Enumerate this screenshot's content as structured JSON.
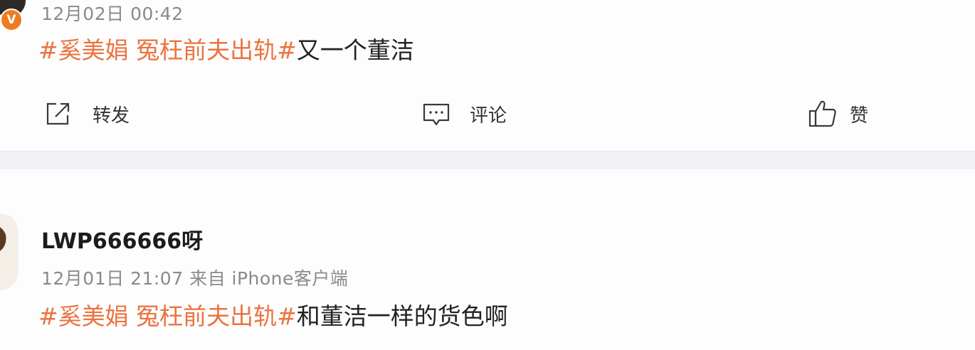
{
  "posts": [
    {
      "timestamp": "12月02日 00:42",
      "badge": "V",
      "topic": "#奚美娟 冤枉前夫出轨#",
      "text": "又一个董洁"
    },
    {
      "username": "LWP666666呀",
      "timestamp": "12月01日 21:07 来自 iPhone客户端",
      "topic": "#奚美娟 冤枉前夫出轨#",
      "text": "和董洁一样的货色啊"
    }
  ],
  "actions": {
    "repost": "转发",
    "comment": "评论",
    "like": "赞"
  },
  "colors": {
    "topic": "#eb7340",
    "badge": "#f07b1e",
    "timestamp": "#8a8a8a",
    "separator": "#f1f2f5"
  },
  "icons": {
    "repost": "share-icon",
    "comment": "comment-icon",
    "like": "thumbs-up-icon",
    "verified": "verified-v-badge"
  }
}
